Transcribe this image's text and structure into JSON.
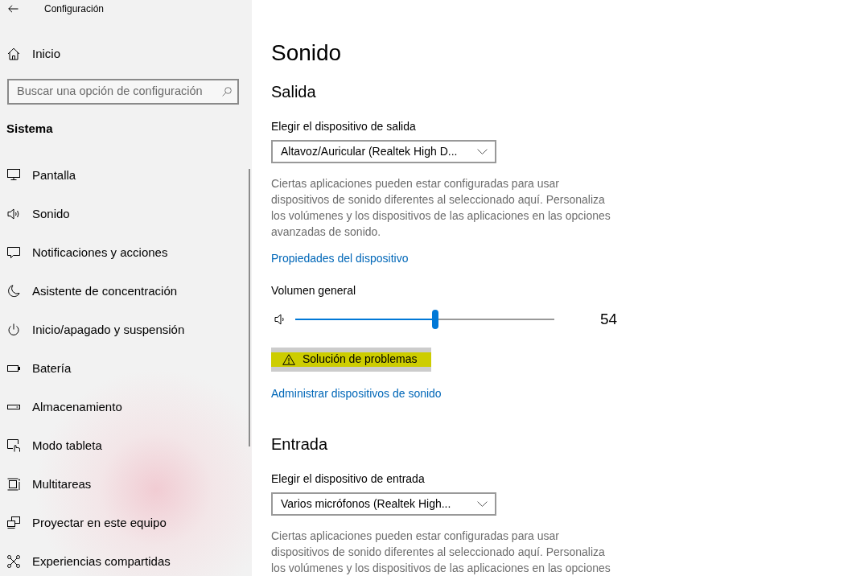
{
  "window": {
    "title": "Configuración"
  },
  "sidebar": {
    "home": "Inicio",
    "search": {
      "placeholder": "Buscar una opción de configuración"
    },
    "section": "Sistema",
    "items": [
      "Pantalla",
      "Sonido",
      "Notificaciones y acciones",
      "Asistente de concentración",
      "Inicio/apagado y suspensión",
      "Batería",
      "Almacenamiento",
      "Modo tableta",
      "Multitareas",
      "Proyectar en este equipo",
      "Experiencias compartidas"
    ]
  },
  "page": {
    "title": "Sonido",
    "sections": [
      {
        "heading": "Salida",
        "device_label": "Elegir el dispositivo de salida",
        "device": "Altavoz/Auricular (Realtek High D...",
        "note": "Ciertas aplicaciones pueden estar configuradas para usar dispositivos de sonido diferentes al seleccionado aquí. Personaliza los volúmenes y los dispositivos de las aplicaciones en las opciones avanzadas de sonido.",
        "link": "Propiedades del dispositivo",
        "volume": {
          "label": "Volumen general",
          "level": 0.54,
          "reading": "54"
        },
        "troubleshoot": "Solución de problemas",
        "manage_link": "Administrar dispositivos de sonido"
      },
      {
        "heading": "Entrada",
        "device_label": "Elegir el dispositivo de entrada",
        "device": "Varios micrófonos (Realtek High...",
        "note": "Ciertas aplicaciones pueden estar configuradas para usar dispositivos de sonido diferentes al seleccionado aquí. Personaliza los volúmenes y los dispositivos de las aplicaciones en las opciones"
      }
    ]
  }
}
